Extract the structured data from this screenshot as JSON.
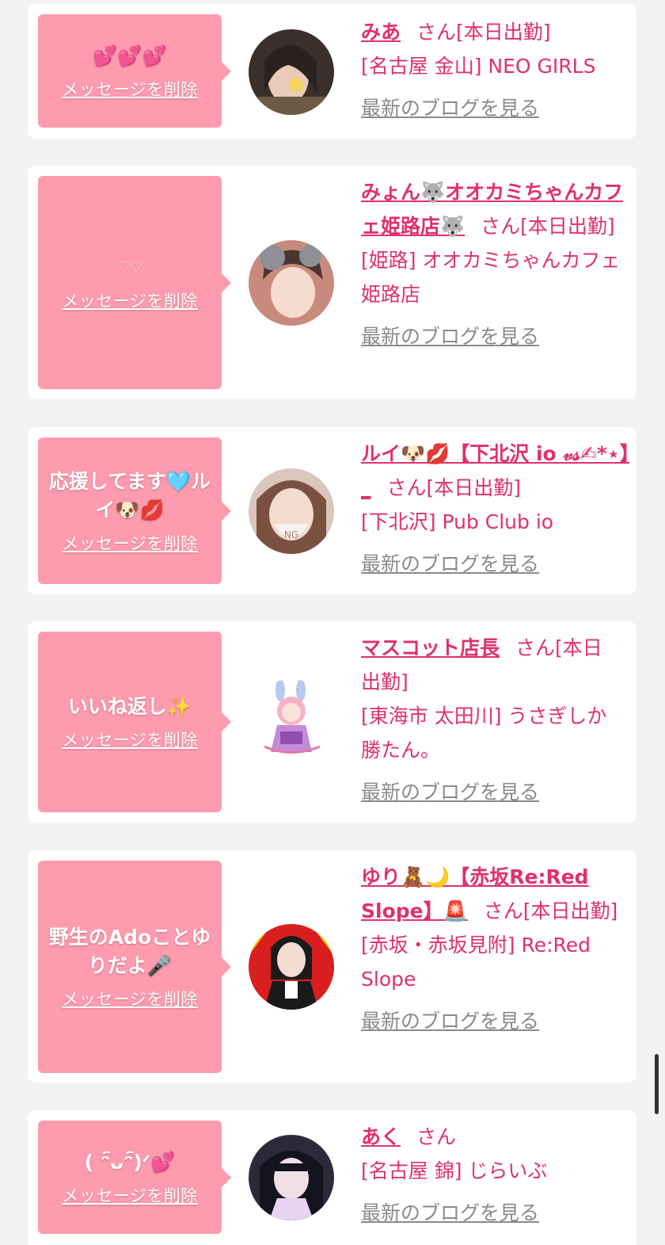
{
  "colors": {
    "page_bg": "#f2f2f2",
    "message_bg": "#ff9bae",
    "accent": "#e0316a",
    "blog_link": "#8a8a8a"
  },
  "common": {
    "delete_label": "メッセージを削除",
    "blog_label": "最新のブログを見る"
  },
  "items": [
    {
      "message": "💕💕💕",
      "name": "みあ",
      "suffix": "さん[本日出勤]",
      "shop": "[名古屋 金山] NEO GIRLS"
    },
    {
      "message": "♡♡",
      "name": "みょん🐺オオカミちゃんカフェ姫路店🐺",
      "suffix": "さん[本日出勤]",
      "shop": "[姫路] オオカミちゃんカフェ姫路店"
    },
    {
      "message": "応援してます🩵ルイ🐶💋",
      "name": "ルイ🐶💋【下北沢 io 𝓋𝓈✍︎*⋆】_",
      "suffix": "さん[本日出勤]",
      "shop": "[下北沢] Pub Club io"
    },
    {
      "message": "いいね返し✨",
      "name": "マスコット店長",
      "suffix": "さん[本日出勤]",
      "shop": "[東海市 太田川] うさぎしか勝たん。"
    },
    {
      "message": "野生のAdoことゆりだよ🎤",
      "name": "ゆり🧸🌙【赤坂Re:Red Slope】🚨",
      "suffix": "さん[本日出勤]",
      "shop": "[赤坂・赤坂見附] Re:Red Slope"
    },
    {
      "message": "( ᵔ︢ᴗᵔ︢)ᐟ💕",
      "name": "あく",
      "suffix": "さん",
      "shop": "[名古屋 錦] じらいぶ"
    }
  ]
}
